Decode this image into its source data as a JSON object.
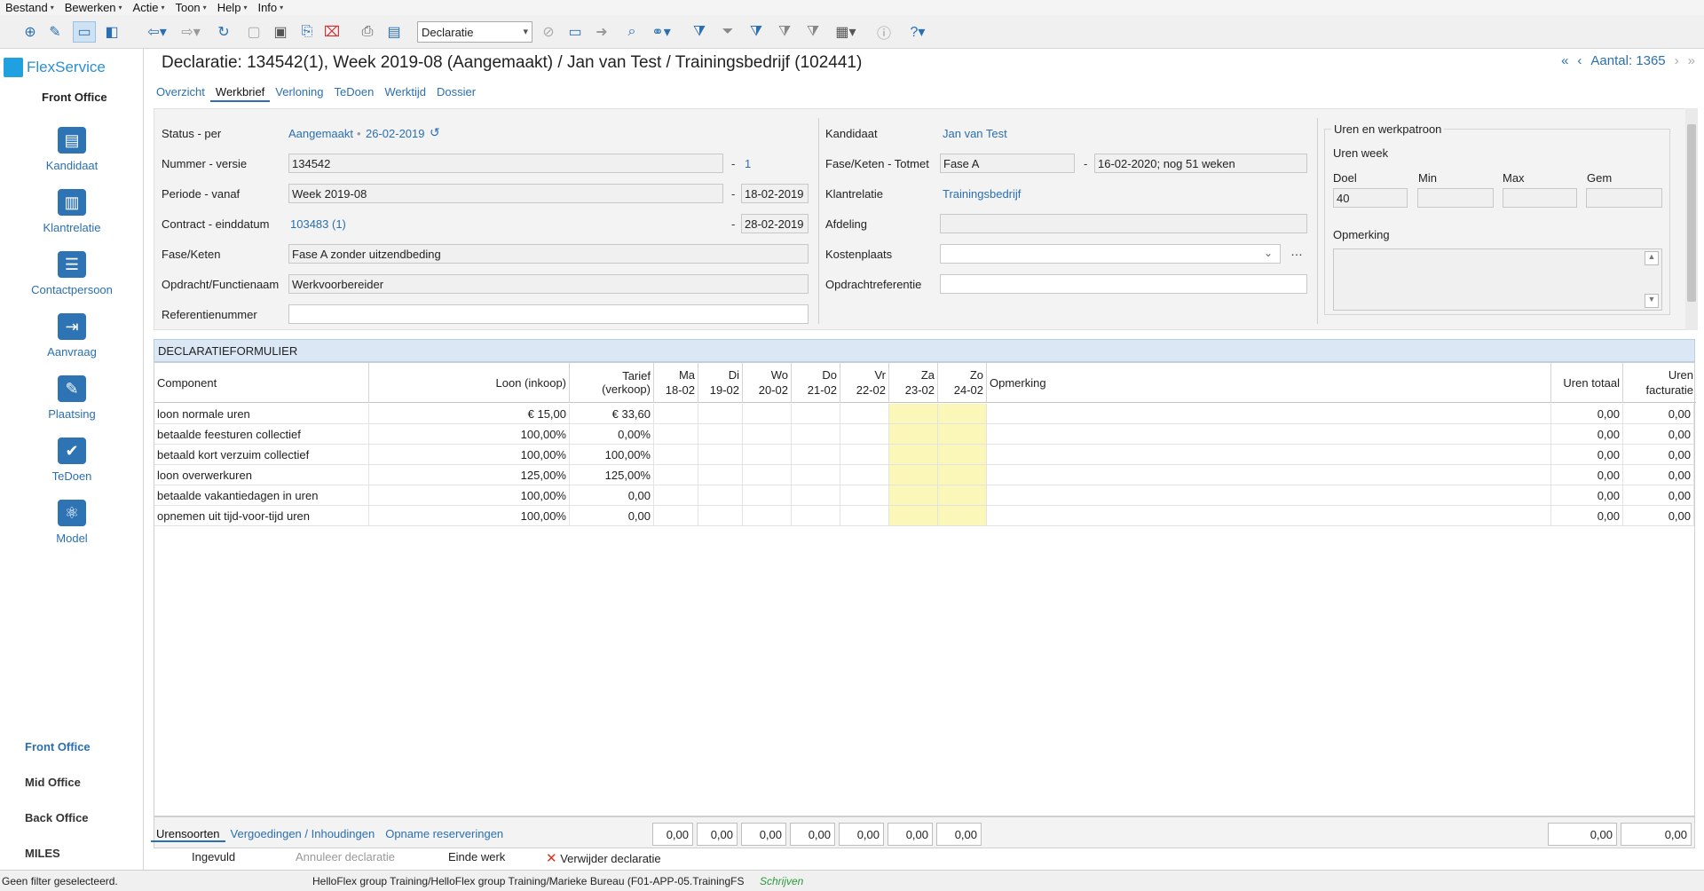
{
  "menu": [
    {
      "label": "Bestand"
    },
    {
      "label": "Bewerken"
    },
    {
      "label": "Actie"
    },
    {
      "label": "Toon"
    },
    {
      "label": "Help"
    },
    {
      "label": "Info"
    }
  ],
  "toolbar": {
    "select_value": "Declaratie"
  },
  "brand": {
    "name": "FlexService",
    "section": "Front Office"
  },
  "nav": [
    {
      "label": "Kandidaat",
      "icon": "id-card-icon"
    },
    {
      "label": "Klantrelatie",
      "icon": "building-icon"
    },
    {
      "label": "Contactpersoon",
      "icon": "contact-book-icon"
    },
    {
      "label": "Aanvraag",
      "icon": "calendar-arrow-icon"
    },
    {
      "label": "Plaatsing",
      "icon": "edit-icon"
    },
    {
      "label": "TeDoen",
      "icon": "clipboard-check-icon"
    },
    {
      "label": "Model",
      "icon": "atom-icon"
    }
  ],
  "bottom_nav": [
    {
      "label": "Front Office"
    },
    {
      "label": "Mid Office"
    },
    {
      "label": "Back Office"
    },
    {
      "label": "MILES"
    }
  ],
  "page": {
    "title": "Declaratie: 134542(1), Week 2019-08 (Aangemaakt) / Jan van Test / Trainingsbedrijf (102441)",
    "count": "Aantal: 1365"
  },
  "tabs": [
    {
      "label": "Overzicht"
    },
    {
      "label": "Werkbrief"
    },
    {
      "label": "Verloning"
    },
    {
      "label": "TeDoen"
    },
    {
      "label": "Werktijd"
    },
    {
      "label": "Dossier"
    }
  ],
  "form": {
    "status_label": "Status - per",
    "status_value": "Aangemaakt",
    "status_date": "26-02-2019",
    "nummer_label": "Nummer - versie",
    "nummer_value": "134542",
    "versie_value": "1",
    "periode_label": "Periode - vanaf",
    "periode_value": "Week 2019-08",
    "periode_date": "18-02-2019",
    "contract_label": "Contract - einddatum",
    "contract_value": "103483 (1)",
    "contract_date": "28-02-2019",
    "fase_label": "Fase/Keten",
    "fase_value": "Fase A zonder uitzendbeding",
    "opdracht_label": "Opdracht/Functienaam",
    "opdracht_value": "Werkvoorbereider",
    "ref_label": "Referentienummer",
    "ref_value": "",
    "kandidaat_label": "Kandidaat",
    "kandidaat_value": "Jan van Test",
    "fasetot_label": "Fase/Keten - Totmet",
    "fasetot_value": "Fase A",
    "fasetot_date": "16-02-2020; nog 51 weken",
    "klant_label": "Klantrelatie",
    "klant_value": "Trainingsbedrijf",
    "afdeling_label": "Afdeling",
    "afdeling_value": "",
    "kosten_label": "Kostenplaats",
    "kosten_value": "",
    "opdrachtref_label": "Opdrachtreferentie",
    "opdrachtref_value": "",
    "uren_group": "Uren en werkpatroon",
    "uren_week": "Uren week",
    "doel_label": "Doel",
    "min_label": "Min",
    "max_label": "Max",
    "gem_label": "Gem",
    "doel_value": "40",
    "opmerking_label": "Opmerking"
  },
  "decl": {
    "header": "DECLARATIEFORMULIER",
    "columns": {
      "component": "Component",
      "loon": "Loon (inkoop)",
      "tarief": "Tarief (verkoop)",
      "opmerking": "Opmerking",
      "uren_totaal": "Uren totaal",
      "uren_fact_1": "Uren",
      "uren_fact_2": "facturatie"
    },
    "days": [
      {
        "day": "Ma",
        "date": "18-02"
      },
      {
        "day": "Di",
        "date": "19-02"
      },
      {
        "day": "Wo",
        "date": "20-02"
      },
      {
        "day": "Do",
        "date": "21-02"
      },
      {
        "day": "Vr",
        "date": "22-02"
      },
      {
        "day": "Za",
        "date": "23-02"
      },
      {
        "day": "Zo",
        "date": "24-02"
      }
    ],
    "rows": [
      {
        "component": "loon normale uren",
        "loon": "€ 15,00",
        "tarief": "€ 33,60",
        "uren_totaal": "0,00",
        "uren_fact": "0,00"
      },
      {
        "component": "betaalde feesturen collectief",
        "loon": "100,00%",
        "tarief": "0,00%",
        "uren_totaal": "0,00",
        "uren_fact": "0,00"
      },
      {
        "component": "betaald kort verzuim collectief",
        "loon": "100,00%",
        "tarief": "100,00%",
        "uren_totaal": "0,00",
        "uren_fact": "0,00"
      },
      {
        "component": "loon overwerkuren",
        "loon": "125,00%",
        "tarief": "125,00%",
        "uren_totaal": "0,00",
        "uren_fact": "0,00"
      },
      {
        "component": "betaalde vakantiedagen in uren",
        "loon": "100,00%",
        "tarief": "0,00",
        "uren_totaal": "0,00",
        "uren_fact": "0,00"
      },
      {
        "component": "opnemen uit tijd-voor-tijd uren",
        "loon": "100,00%",
        "tarief": "0,00",
        "uren_totaal": "0,00",
        "uren_fact": "0,00"
      }
    ],
    "totals": {
      "days": [
        "0,00",
        "0,00",
        "0,00",
        "0,00",
        "0,00",
        "0,00",
        "0,00"
      ],
      "uren_totaal": "0,00",
      "uren_fact": "0,00"
    }
  },
  "subtabs": [
    {
      "label": "Urensoorten"
    },
    {
      "label": "Vergoedingen / Inhoudingen"
    },
    {
      "label": "Opname reserveringen"
    }
  ],
  "actions": {
    "ingevuld": "Ingevuld",
    "annuleer": "Annuleer declaratie",
    "einde": "Einde werk",
    "verwijder": "Verwijder declaratie"
  },
  "status": {
    "filter": "Geen filter geselecteerd.",
    "path": "HelloFlex group Training/HelloFlex group Training/Marieke Bureau (F01-APP-05.TrainingFS",
    "mode": "Schrijven"
  }
}
